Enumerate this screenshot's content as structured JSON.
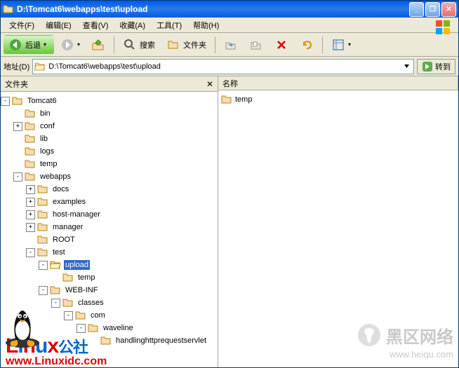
{
  "window": {
    "title": "D:\\Tomcat6\\webapps\\test\\upload"
  },
  "menu": {
    "file": "文件(F)",
    "edit": "编辑(E)",
    "view": "查看(V)",
    "favorites": "收藏(A)",
    "tools": "工具(T)",
    "help": "帮助(H)"
  },
  "toolbar": {
    "back": "后退",
    "search": "搜索",
    "folders": "文件夹"
  },
  "addressbar": {
    "label": "地址(D)",
    "path": "D:\\Tomcat6\\webapps\\test\\upload",
    "go": "转到"
  },
  "panels": {
    "folders_title": "文件夹",
    "list_col_name": "名称"
  },
  "tree": {
    "root": "Tomcat6",
    "bin": "bin",
    "conf": "conf",
    "lib": "lib",
    "logs": "logs",
    "temp": "temp",
    "webapps": "webapps",
    "docs": "docs",
    "examples": "examples",
    "hostmanager": "host-manager",
    "manager": "manager",
    "ROOT": "ROOT",
    "test": "test",
    "upload": "upload",
    "upload_temp": "temp",
    "webinf": "WEB-INF",
    "classes": "classes",
    "com": "com",
    "waveline": "waveline",
    "handler": "handlinghttprequestservlet"
  },
  "list": {
    "item0": "temp"
  },
  "watermarks": {
    "linux_title": "Linux",
    "linux_suffix": "公社",
    "linux_url": "www.Linuxidc.com",
    "heiqu_title": "黑区网络",
    "heiqu_url": "www.heiqu.com"
  }
}
